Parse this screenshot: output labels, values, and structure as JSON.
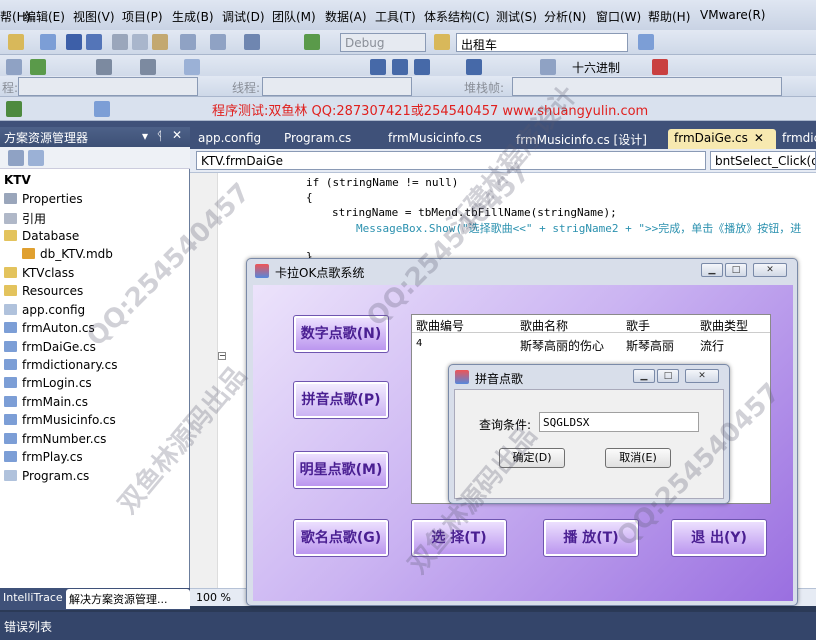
{
  "menu": [
    "帮(H)",
    "编辑(E)",
    "视图(V)",
    "项目(P)",
    "生成(B)",
    "调试(D)",
    "团队(M)",
    "数据(A)",
    "工具(T)",
    "体系结构(C)",
    "测试(S)",
    "分析(N)",
    "窗口(W)",
    "帮助(H)",
    "VMware(R)"
  ],
  "toolbar": {
    "config_combo": "Debug",
    "project_combo": "出租车",
    "hex_label": "十六进制",
    "process_label": "程:",
    "thread_label": "线程:",
    "stack_label": "堆栈帧:"
  },
  "promo_text": "程序测试:双鱼林 QQ:287307421或254540457 www.shuangyulin.com",
  "solution": {
    "title": "方案资源管理器",
    "project": "KTV",
    "items": [
      "Properties",
      "引用",
      "Database",
      "db_KTV.mdb",
      "KTVclass",
      "Resources",
      "app.config",
      "frmAuton.cs",
      "frmDaiGe.cs",
      "frmdictionary.cs",
      "frmLogin.cs",
      "frmMain.cs",
      "frmMusicinfo.cs",
      "frmNumber.cs",
      "frmPlay.cs",
      "Program.cs"
    ]
  },
  "tabs": [
    "app.config",
    "Program.cs",
    "frmMusicinfo.cs",
    "frmMusicinfo.cs [设计]",
    "frmDaiGe.cs",
    "frmdic"
  ],
  "nav": {
    "class_combo": "KTV.frmDaiGe",
    "method_combo": "bntSelect_Click(o"
  },
  "code": [
    "if (stringName != null)",
    "{",
    "stringName = tbMend.tbFillName(stringName);",
    "MessageBox.Show(\"选择歌曲<<\" + strigName2 + \">>完成，单击《播放》按钮，进",
    "}"
  ],
  "zoom": "100 %",
  "bottom_tabs": [
    "IntelliTrace",
    "解决方案资源管理..."
  ],
  "error_list": "错误列表",
  "karaoke": {
    "title": "卡拉OK点歌系统",
    "buttons": {
      "digit": "数字点歌(N)",
      "pinyin": "拼音点歌(P)",
      "star": "明星点歌(M)",
      "name": "歌名点歌(G)",
      "select": "选 择(T)",
      "play": "播 放(T)",
      "exit": "退 出(Y)"
    },
    "columns": [
      "歌曲编号",
      "歌曲名称",
      "歌手",
      "歌曲类型"
    ],
    "rows": [
      [
        "4",
        "斯琴高丽的伤心",
        "斯琴高丽",
        "流行"
      ]
    ]
  },
  "pinyin_dialog": {
    "title": "拼音点歌",
    "label": "查询条件:",
    "value": "SQGLDSX",
    "ok": "确定(D)",
    "cancel": "取消(E)"
  },
  "watermarks": [
    "QQ:254540457",
    "双鱼林源码出品",
    "汪建林程序设计"
  ],
  "colors": {
    "tab_active": "#f7e9b0",
    "purple_text": "#4a1f92",
    "promo_red": "#e0201e"
  }
}
